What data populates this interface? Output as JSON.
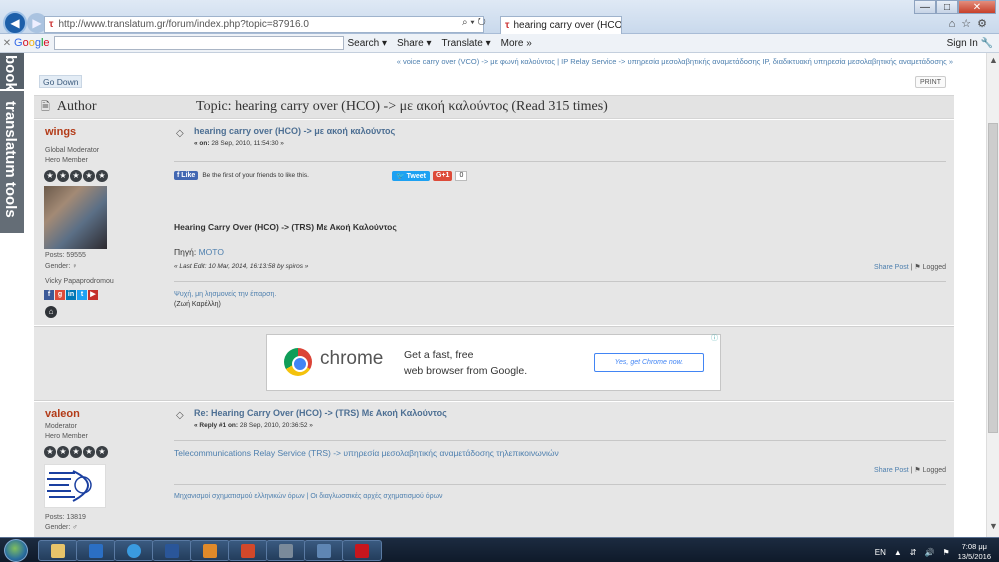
{
  "browser": {
    "url": "http://www.translatum.gr/forum/index.php?topic=87916.0",
    "tab_title": "hearing carry over (HCO) -...",
    "win_minimize": "—",
    "win_maximize": "□",
    "win_close": "✕"
  },
  "google_toolbar": {
    "logo": [
      "G",
      "o",
      "o",
      "g",
      "l",
      "e"
    ],
    "search_label": "Search",
    "share_label": "Share",
    "translate_label": "Translate",
    "more_label": "More »",
    "signin_label": "Sign In"
  },
  "sidebar": {
    "top_label": "book",
    "main_label": "translatum tools"
  },
  "forum": {
    "linktree": "« voice carry over (VCO) -> με φωνή καλούντος | IP Relay Service -> υπηρεσία μεσολαβητικής αναμετάδοσης IP, διαδικτυακή υπηρεσία μεσολαβητικής αναμετάδοσης »",
    "go_down": "Go Down",
    "print": "PRINT",
    "author_header": "Author",
    "topic_header": "Topic: hearing carry over (HCO) -> με ακοή καλούντος  (Read 315 times)"
  },
  "posts": [
    {
      "username": "wings",
      "role": "Global Moderator",
      "member_type": "Hero Member",
      "stars": 5,
      "posts": "Posts: 59555",
      "gender": "Gender: ♀",
      "realname": "Vicky Papaprodromou",
      "subject": "hearing carry over (HCO) -> με ακοή καλούντος",
      "date_prefix": "« on:",
      "date": "28 Sep, 2010, 11:54:30 »",
      "fb_like": "Like",
      "fb_text": "Be the first of your friends to like this.",
      "tweet": "Tweet",
      "gplus": "G+1",
      "gplus_count": "0",
      "body_title": "Hearing Carry Over (HCO) -> (TRS) Με Ακοή Καλούντος",
      "source_prefix": "Πηγή:",
      "source_link": "ΜΟΤΟ",
      "last_edit": "« Last Edit: 10 Mar, 2014, 16:13:58 by spiros »",
      "share_post": "Share Post",
      "logged": "Logged",
      "sig_line1": "Ψυχή, μη λησμονείς την έπαρση.",
      "sig_line2": "(Ζωή Καρέλλη)"
    },
    {
      "username": "valeon",
      "role": "Moderator",
      "member_type": "Hero Member",
      "stars": 5,
      "posts": "Posts: 13819",
      "gender": "Gender: ♂",
      "subject": "Re: Hearing Carry Over (HCO) -> (TRS) Με Ακοή Καλούντος",
      "date_prefix": "« Reply #1 on:",
      "date": "28 Sep, 2010, 20:36:52 »",
      "body_link": "Telecommunications Relay Service (TRS) -> υπηρεσία μεσολαβητικής αναμετάδοσης τηλεπικοινωνιών",
      "share_post": "Share Post",
      "logged": "Logged",
      "sig_link1": "Μηχανισμοί σχηματισμού ελληνικών όρων",
      "sig_link2": "Οι διαγλωσσικές αρχές σχηματισμού όρων"
    }
  ],
  "ad": {
    "brand": "chrome",
    "line1": "Get a fast, free",
    "line2": "web browser from Google.",
    "cta": "Yes, get Chrome now."
  },
  "taskbar": {
    "lang": "EN",
    "time": "7:08 μμ",
    "date": "13/5/2016"
  }
}
